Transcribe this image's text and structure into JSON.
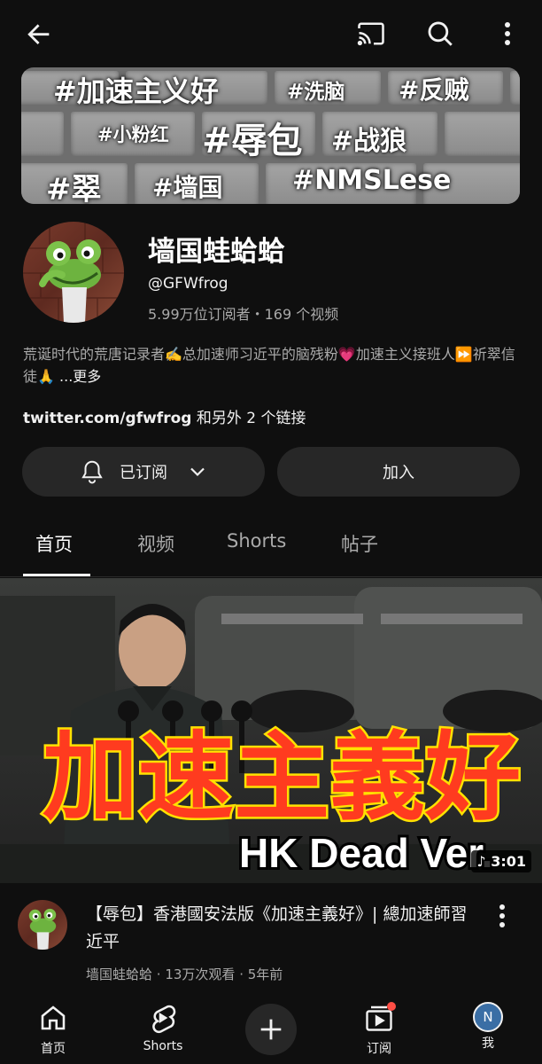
{
  "topbar": {
    "icons": [
      "back-arrow-icon",
      "cast-icon",
      "search-icon",
      "more-vert-icon"
    ]
  },
  "banner": {
    "tags": {
      "t1": "#加速主义好",
      "t2": "#洗脑",
      "t3": "#反贼",
      "t4": "#小粉红",
      "t5": "#辱包",
      "t6": "#战狼",
      "t7": "#翠",
      "t8": "#墙国",
      "t9": "#NMSLese"
    }
  },
  "channel": {
    "name": "墙国蛙蛤蛤",
    "handle": "@GFWfrog",
    "stats": "5.99万位订阅者・169 个视频",
    "description": "荒诞时代的荒唐记录者✍️总加速师习近平的脑残粉💗加速主义接班人⏩祈翠信徒🙏",
    "more": " ...更多",
    "link": "twitter.com/gfwfrog",
    "link_rest": " 和另外 2 个链接"
  },
  "actions": {
    "subscribed": "已订阅",
    "join": "加入"
  },
  "tabs": {
    "home": "首页",
    "videos": "视频",
    "shorts": "Shorts",
    "posts": "帖子"
  },
  "video": {
    "thumb_text": "加速主義好",
    "thumb_subtext": "HK Dead Ver.",
    "duration": "3:01",
    "title": "【辱包】香港國安法版《加速主義好》| 總加速師習近平",
    "channel": "墙国蛙蛤蛤",
    "views": "13万次观看",
    "age": "5年前",
    "meta_sep": " · "
  },
  "nav": {
    "home": "首页",
    "shorts": "Shorts",
    "subscriptions": "订阅",
    "you": "我",
    "avatar_letter": "N"
  },
  "colors": {
    "background": "#0f0f0f",
    "surface": "#272727",
    "secondary_text": "#aaaaaa",
    "notification_dot": "#ff4e45",
    "thumb_text": "#ff3b1f",
    "thumb_text_stroke": "#ffe100",
    "avatar_n": "#3a6ea5"
  }
}
